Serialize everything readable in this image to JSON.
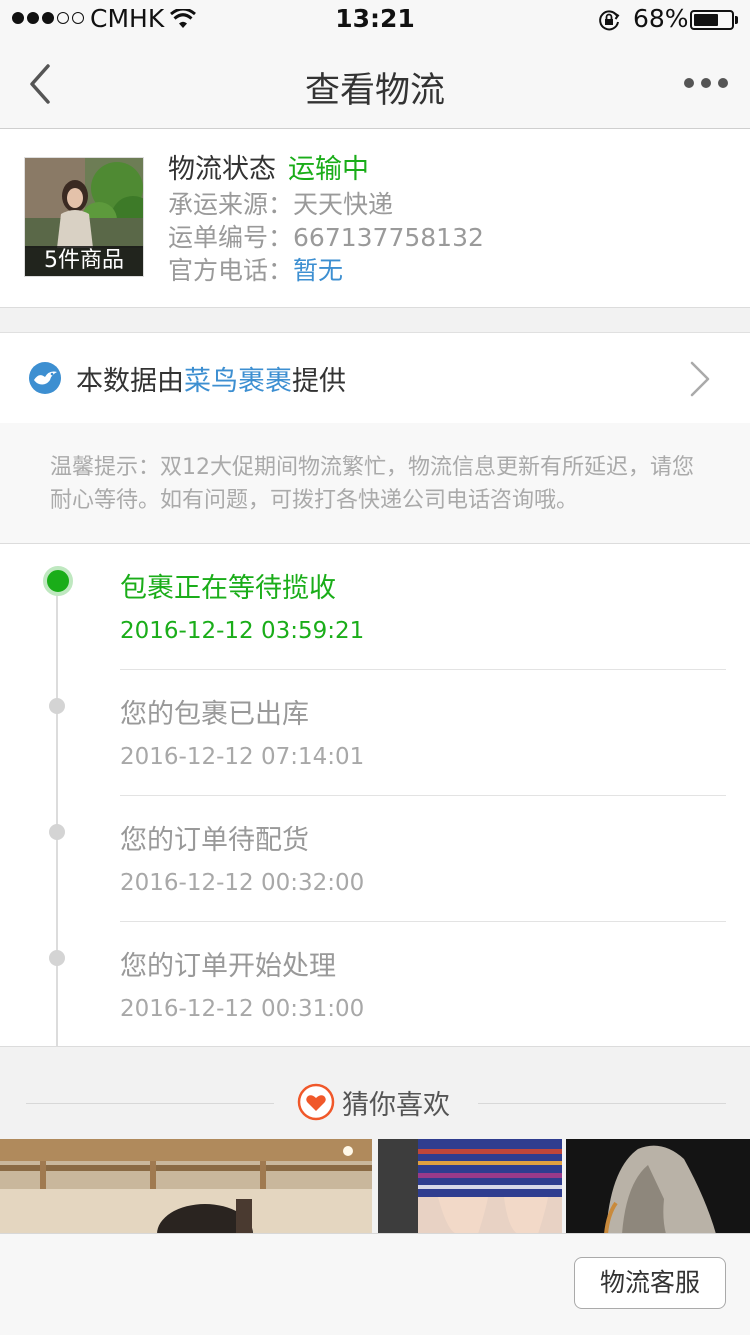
{
  "status_bar": {
    "signal": [
      true,
      true,
      true,
      false,
      false
    ],
    "carrier": "CMHK",
    "time": "13:21",
    "battery_percent": "68%",
    "battery_level": 0.68,
    "icons": [
      "wifi-icon",
      "orientation-lock-icon",
      "battery-icon"
    ]
  },
  "nav": {
    "title": "查看物流",
    "back_icon": "chevron-left-icon",
    "more_icon": "more-dots-icon"
  },
  "info": {
    "thumb_caption": "5件商品",
    "status_label": "物流状态",
    "status_value": "运输中",
    "carrier_label": "承运来源：",
    "carrier_value": "天天快递",
    "tracking_label": "运单编号：",
    "tracking_value": "667137758132",
    "phone_label": "官方电话：",
    "phone_value": "暂无"
  },
  "provider": {
    "prefix": "本数据由",
    "name": "菜鸟裹裹",
    "suffix": "提供",
    "icon": "cainiao-bird-icon"
  },
  "notice": {
    "text": "温馨提示：双12大促期间物流繁忙，物流信息更新有所延迟，请您耐心等待。如有问题，可拨打各快递公司电话咨询哦。"
  },
  "timeline": {
    "items": [
      {
        "title": "包裹正在等待揽收",
        "time": "2016-12-12 03:59:21",
        "active": true
      },
      {
        "title": "您的包裹已出库",
        "time": "2016-12-12 07:14:01",
        "active": false
      },
      {
        "title": "您的订单待配货",
        "time": "2016-12-12 00:32:00",
        "active": false
      },
      {
        "title": "您的订单开始处理",
        "time": "2016-12-12 00:31:00",
        "active": false
      }
    ]
  },
  "recommend": {
    "title": "猜你喜欢",
    "icon": "heart-icon"
  },
  "bottom": {
    "service_button": "物流客服"
  },
  "colors": {
    "accent_green": "#1aad19",
    "link_blue": "#3d8fd1",
    "heart_orange": "#f0582a"
  }
}
